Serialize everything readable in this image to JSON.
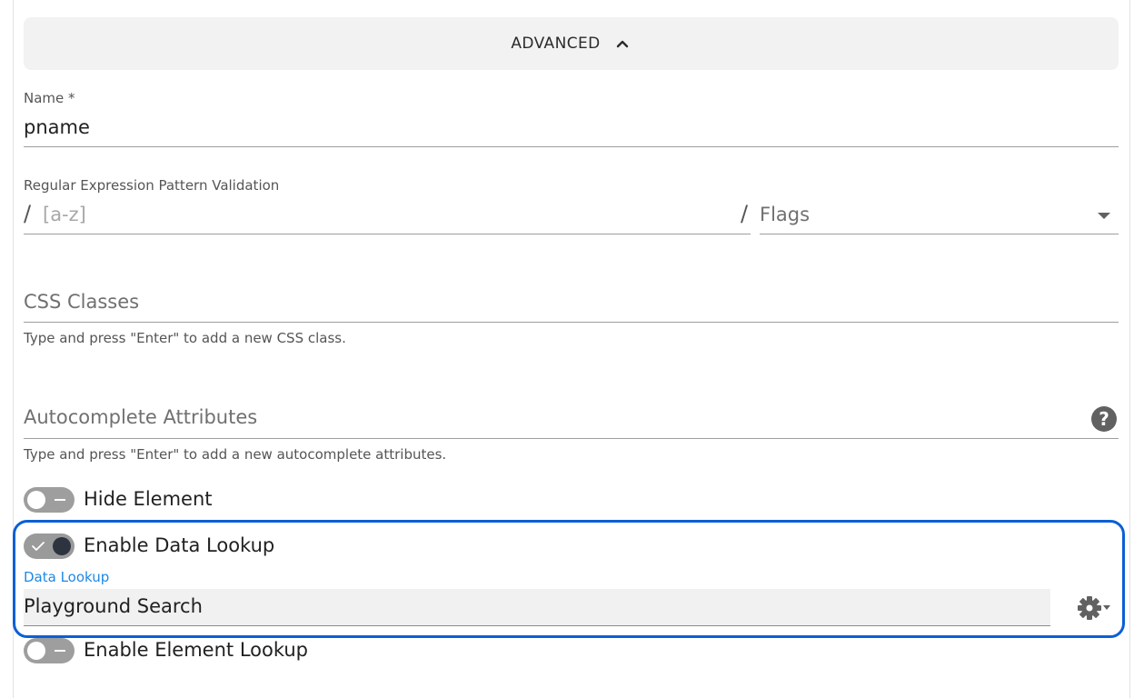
{
  "advanced_section": {
    "label": "ADVANCED",
    "chevron_icon": "chevron-up-icon"
  },
  "name_field": {
    "label": "Name *",
    "value": "pname"
  },
  "regex_field": {
    "label": "Regular Expression Pattern Validation",
    "open_slash": "/",
    "placeholder": "[a-z]",
    "close_slash": "/",
    "flags_placeholder": "Flags"
  },
  "css_classes": {
    "placeholder": "CSS Classes",
    "hint": "Type and press \"Enter\" to add a new CSS class."
  },
  "autocomplete": {
    "placeholder": "Autocomplete Attributes",
    "help_icon": "?",
    "hint": "Type and press \"Enter\" to add a new autocomplete attributes."
  },
  "toggles": {
    "hide_element": {
      "label": "Hide Element",
      "checked": false
    },
    "enable_data_lookup": {
      "label": "Enable Data Lookup",
      "checked": true
    },
    "enable_element_lookup": {
      "label": "Enable Element Lookup",
      "checked": false
    }
  },
  "data_lookup": {
    "label": "Data Lookup",
    "value": "Playground Search",
    "settings_icon": "gear-icon"
  },
  "colors": {
    "accent": "#1e88e5",
    "highlight_border": "#0b5fd6",
    "toggle_on_knob": "#2d3440"
  }
}
